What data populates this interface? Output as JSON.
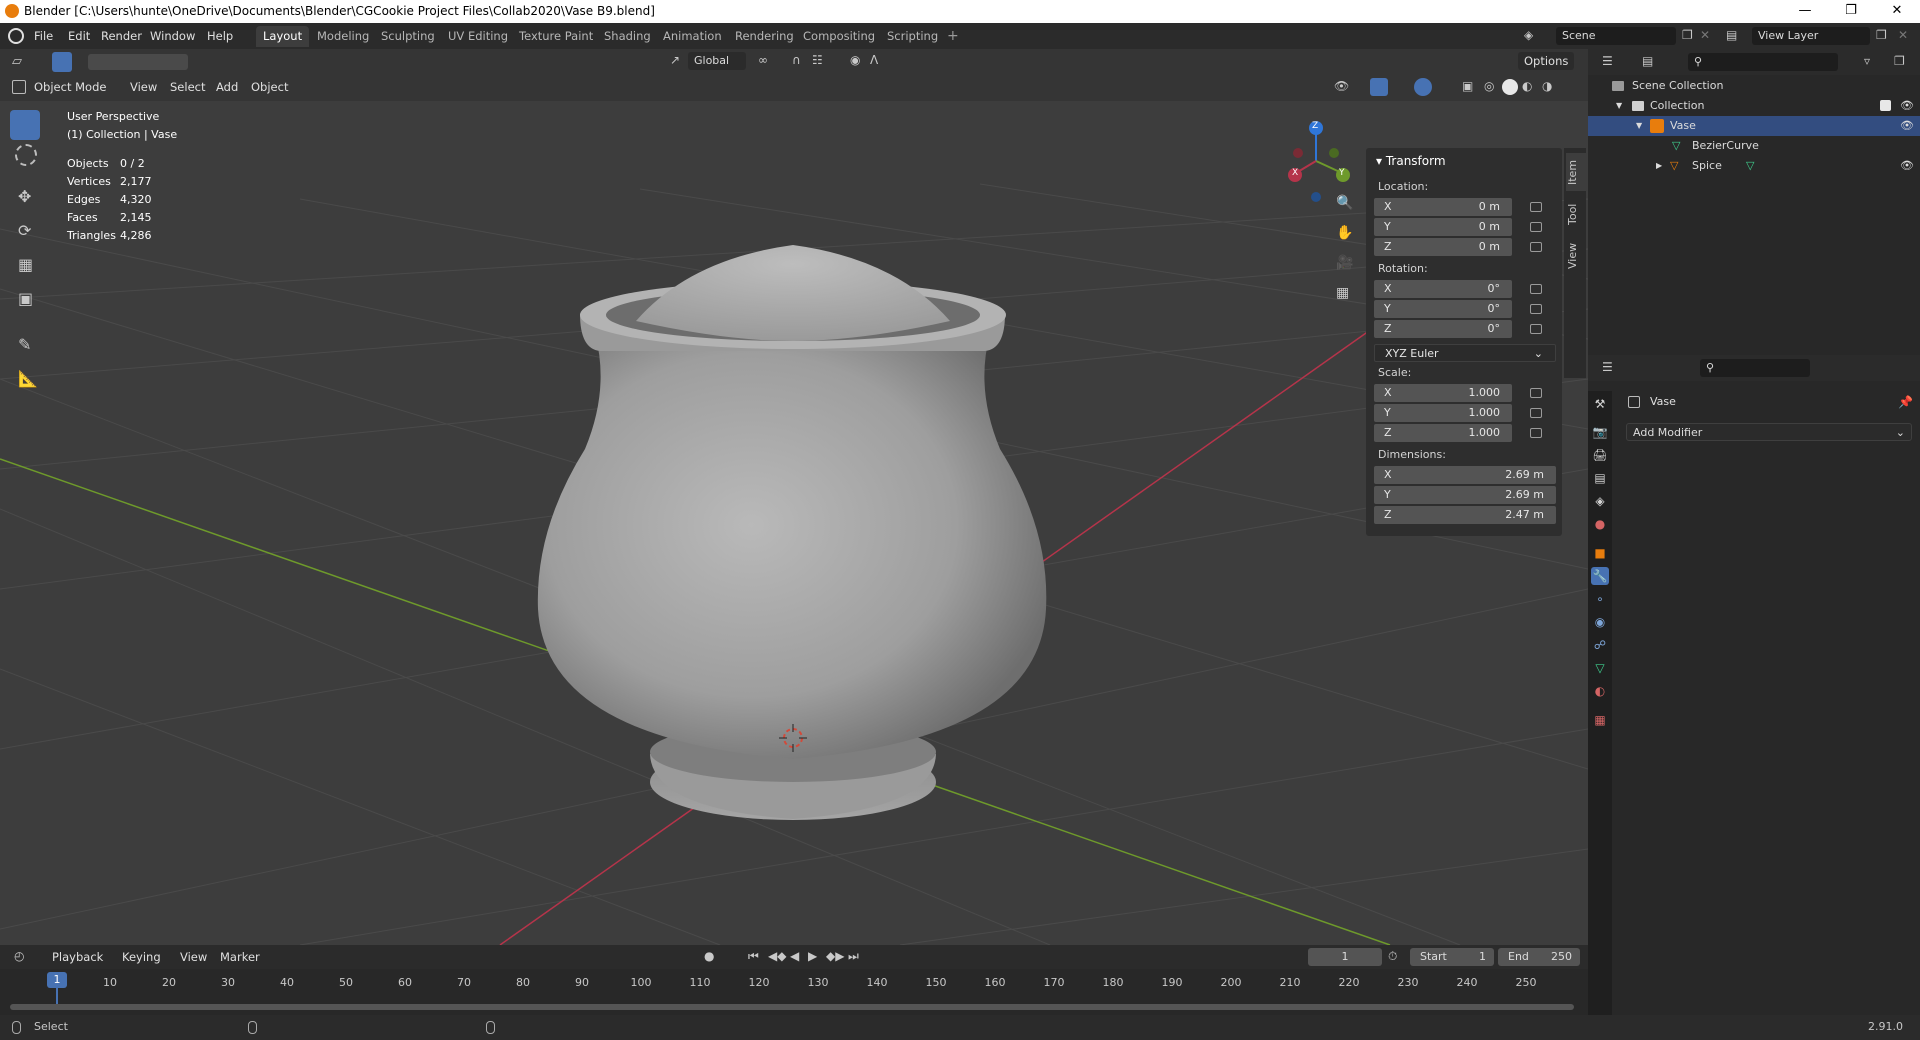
{
  "window": {
    "title": "Blender [C:\\Users\\hunte\\OneDrive\\Documents\\Blender\\CGCookie Project Files\\Collab2020\\Vase B9.blend]"
  },
  "menu": [
    "File",
    "Edit",
    "Render",
    "Window",
    "Help"
  ],
  "workspaces": [
    "Layout",
    "Modeling",
    "Sculpting",
    "UV Editing",
    "Texture Paint",
    "Shading",
    "Animation",
    "Rendering",
    "Compositing",
    "Scripting"
  ],
  "scene": "Scene",
  "view_layer": "View Layer",
  "viewport_header": {
    "orientation": "Global",
    "options": "Options",
    "mode": "Object Mode",
    "menus": [
      "View",
      "Select",
      "Add",
      "Object"
    ]
  },
  "overlay_text": {
    "perspective": "User Perspective",
    "collection": "(1) Collection | Vase",
    "stats": [
      {
        "label": "Objects",
        "value": "0 / 2"
      },
      {
        "label": "Vertices",
        "value": "2,177"
      },
      {
        "label": "Edges",
        "value": "4,320"
      },
      {
        "label": "Faces",
        "value": "2,145"
      },
      {
        "label": "Triangles",
        "value": "4,286"
      }
    ]
  },
  "gizmo": {
    "x": "X",
    "y": "Y",
    "z": "Z"
  },
  "npanel": {
    "header": "Transform",
    "tabs": [
      "Item",
      "Tool",
      "View"
    ],
    "location_label": "Location:",
    "location": [
      {
        "axis": "X",
        "value": "0 m"
      },
      {
        "axis": "Y",
        "value": "0 m"
      },
      {
        "axis": "Z",
        "value": "0 m"
      }
    ],
    "rotation_label": "Rotation:",
    "rotation": [
      {
        "axis": "X",
        "value": "0°"
      },
      {
        "axis": "Y",
        "value": "0°"
      },
      {
        "axis": "Z",
        "value": "0°"
      }
    ],
    "rotation_mode": "XYZ Euler",
    "scale_label": "Scale:",
    "scale": [
      {
        "axis": "X",
        "value": "1.000"
      },
      {
        "axis": "Y",
        "value": "1.000"
      },
      {
        "axis": "Z",
        "value": "1.000"
      }
    ],
    "dimensions_label": "Dimensions:",
    "dimensions": [
      {
        "axis": "X",
        "value": "2.69 m"
      },
      {
        "axis": "Y",
        "value": "2.69 m"
      },
      {
        "axis": "Z",
        "value": "2.47 m"
      }
    ]
  },
  "outliner": {
    "rows": [
      {
        "label": "Scene Collection"
      },
      {
        "label": "Collection"
      },
      {
        "label": "Vase"
      },
      {
        "label": "BezierCurve"
      },
      {
        "label": "Spice"
      }
    ]
  },
  "properties": {
    "object_name": "Vase",
    "add_modifier": "Add Modifier"
  },
  "timeline": {
    "menus": [
      "Playback",
      "Keying",
      "View",
      "Marker"
    ],
    "current_frame": "1",
    "start_label": "Start",
    "start": "1",
    "end_label": "End",
    "end": "250",
    "ruler": [
      "1",
      "10",
      "20",
      "30",
      "40",
      "50",
      "60",
      "70",
      "80",
      "90",
      "100",
      "110",
      "120",
      "130",
      "140",
      "150",
      "160",
      "170",
      "180",
      "190",
      "200",
      "210",
      "220",
      "230",
      "240",
      "250"
    ]
  },
  "status": {
    "left": "Select",
    "version": "2.91.0"
  },
  "colors": {
    "accent": "#4772b3",
    "x_axis": "#b5344a",
    "y_axis": "#6e9a2b",
    "z_axis": "#2f76d8",
    "object_orange": "#e87d0d"
  }
}
